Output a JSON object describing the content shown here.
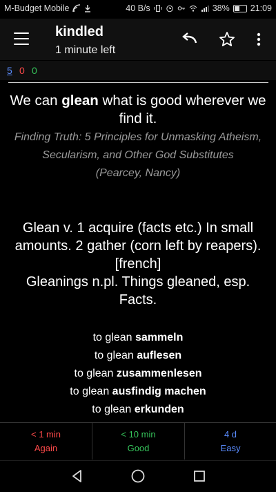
{
  "status_bar": {
    "carrier": "M-Budget Mobile",
    "speed": "40 B/s",
    "battery": "38%",
    "time": "21:09",
    "battery_level": 0.38
  },
  "toolbar": {
    "title": "kindled",
    "subtitle": "1 minute left",
    "icons": [
      "menu-icon",
      "undo-icon",
      "star-icon",
      "more-vert-icon"
    ]
  },
  "counts": {
    "new": "5",
    "learning": "0",
    "review": "0"
  },
  "card": {
    "quote_prefix": "We can ",
    "quote_bold": "glean",
    "quote_suffix": " what is good wherever we find it.",
    "source_title": "Finding Truth: 5 Principles for Unmasking Atheism, Secularism, and Other God Substitutes",
    "source_author": "(Pearcey, Nancy)",
    "definition_1": "Glean v. 1 acquire (facts etc.) In small amounts. 2 gather (corn left by reapers). [french]",
    "definition_2": "Gleanings n.pl. Things gleaned, esp. Facts.",
    "translations": [
      {
        "prefix": "to glean ",
        "word": "sammeln"
      },
      {
        "prefix": "to glean ",
        "word": "auflesen"
      },
      {
        "prefix": "to glean ",
        "word": "zusammenlesen"
      },
      {
        "prefix": "to glean ",
        "word": "ausfindig machen"
      },
      {
        "prefix": "to glean ",
        "word": "erkunden"
      }
    ]
  },
  "answers": {
    "again": {
      "time": "< 1 min",
      "label": "Again"
    },
    "good": {
      "time": "< 10 min",
      "label": "Good"
    },
    "easy": {
      "time": "4 d",
      "label": "Easy"
    }
  },
  "nav": [
    "back-icon",
    "home-icon",
    "recents-icon"
  ]
}
